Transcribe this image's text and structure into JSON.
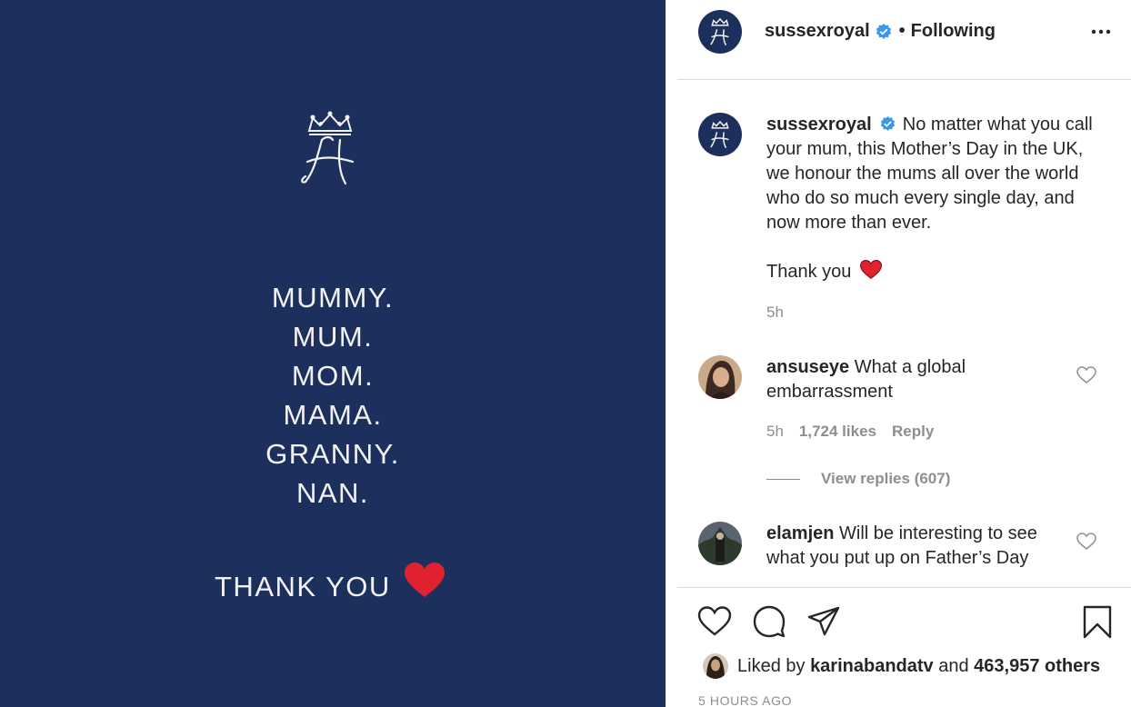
{
  "image": {
    "background": "#1d2f5c",
    "words": [
      "MUMMY.",
      "MUM.",
      "MOM.",
      "MAMA.",
      "GRANNY.",
      "NAN."
    ],
    "thank_you": "THANK YOU",
    "heart_color": "#e0212e"
  },
  "header": {
    "username": "sussexroyal",
    "separator": "•",
    "follow_status": "Following",
    "more_icon": "more-horizontal-icon"
  },
  "caption": {
    "username": "sussexroyal",
    "text": "No matter what you call your mum, this Mother’s Day in the UK, we honour the mums all over the world who do so much every single day, and now more than ever.",
    "thanks": "Thank you",
    "time": "5h"
  },
  "comments": [
    {
      "username": "ansuseye",
      "text": "What a global embarrassment",
      "time": "5h",
      "likes": "1,724 likes",
      "reply_label": "Reply",
      "view_replies": "View replies (607)"
    },
    {
      "username": "elamjen",
      "text": "Will be interesting to see what you put up on Father’s Day"
    }
  ],
  "actions": {
    "like_icon": "heart-icon",
    "comment_icon": "comment-icon",
    "share_icon": "share-icon",
    "save_icon": "bookmark-icon"
  },
  "likes": {
    "prefix": "Liked by",
    "user": "karinabandatv",
    "conjunction": "and",
    "others": "463,957 others"
  },
  "timestamp": "5 HOURS AGO",
  "colors": {
    "verified": "#3897f0",
    "secondary_text": "#8e8e8e",
    "primary_text": "#262626"
  }
}
